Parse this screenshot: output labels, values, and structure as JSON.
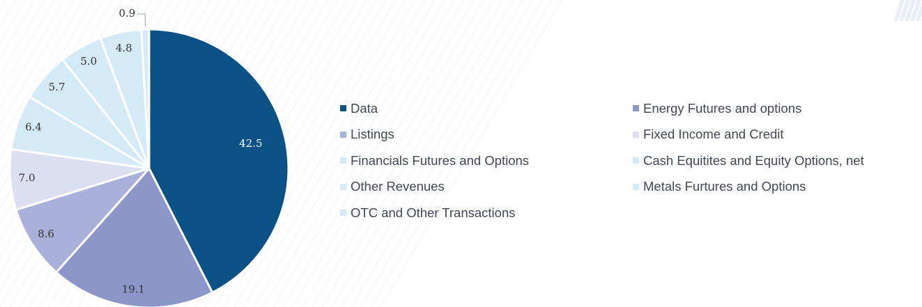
{
  "chart_data": {
    "type": "pie",
    "title": "",
    "slices": [
      {
        "name": "Data",
        "value": 42.5,
        "label": "42.5",
        "color": "#0a5286",
        "label_color": "#ffffff"
      },
      {
        "name": "Energy Futures and options",
        "value": 19.1,
        "label": "19.1",
        "color": "#8d96c9",
        "label_color": "#333333"
      },
      {
        "name": "Listings",
        "value": 8.6,
        "label": "8.6",
        "color": "#a9b0d9",
        "label_color": "#333333"
      },
      {
        "name": "Fixed Income and Credit",
        "value": 7.0,
        "label": "7.0",
        "color": "#dcdff0",
        "label_color": "#333333"
      },
      {
        "name": "Financials Futures and Options",
        "value": 6.4,
        "label": "6.4",
        "color": "#d4eaf7",
        "label_color": "#333333"
      },
      {
        "name": "Cash Equitites and Equity Options, net",
        "value": 5.7,
        "label": "5.7",
        "color": "#d4eaf7",
        "label_color": "#333333"
      },
      {
        "name": "Other Revenues",
        "value": 5.0,
        "label": "5.0",
        "color": "#d4eaf7",
        "label_color": "#333333"
      },
      {
        "name": "Metals Furtures and Options",
        "value": 4.8,
        "label": "4.8",
        "color": "#d4eaf7",
        "label_color": "#333333"
      },
      {
        "name": "OTC and Other Transactions",
        "value": 0.9,
        "label": "0.9",
        "color": "#d4eaf7",
        "label_color": "#333333"
      }
    ],
    "legend_position": "right",
    "legend_columns": 2
  }
}
